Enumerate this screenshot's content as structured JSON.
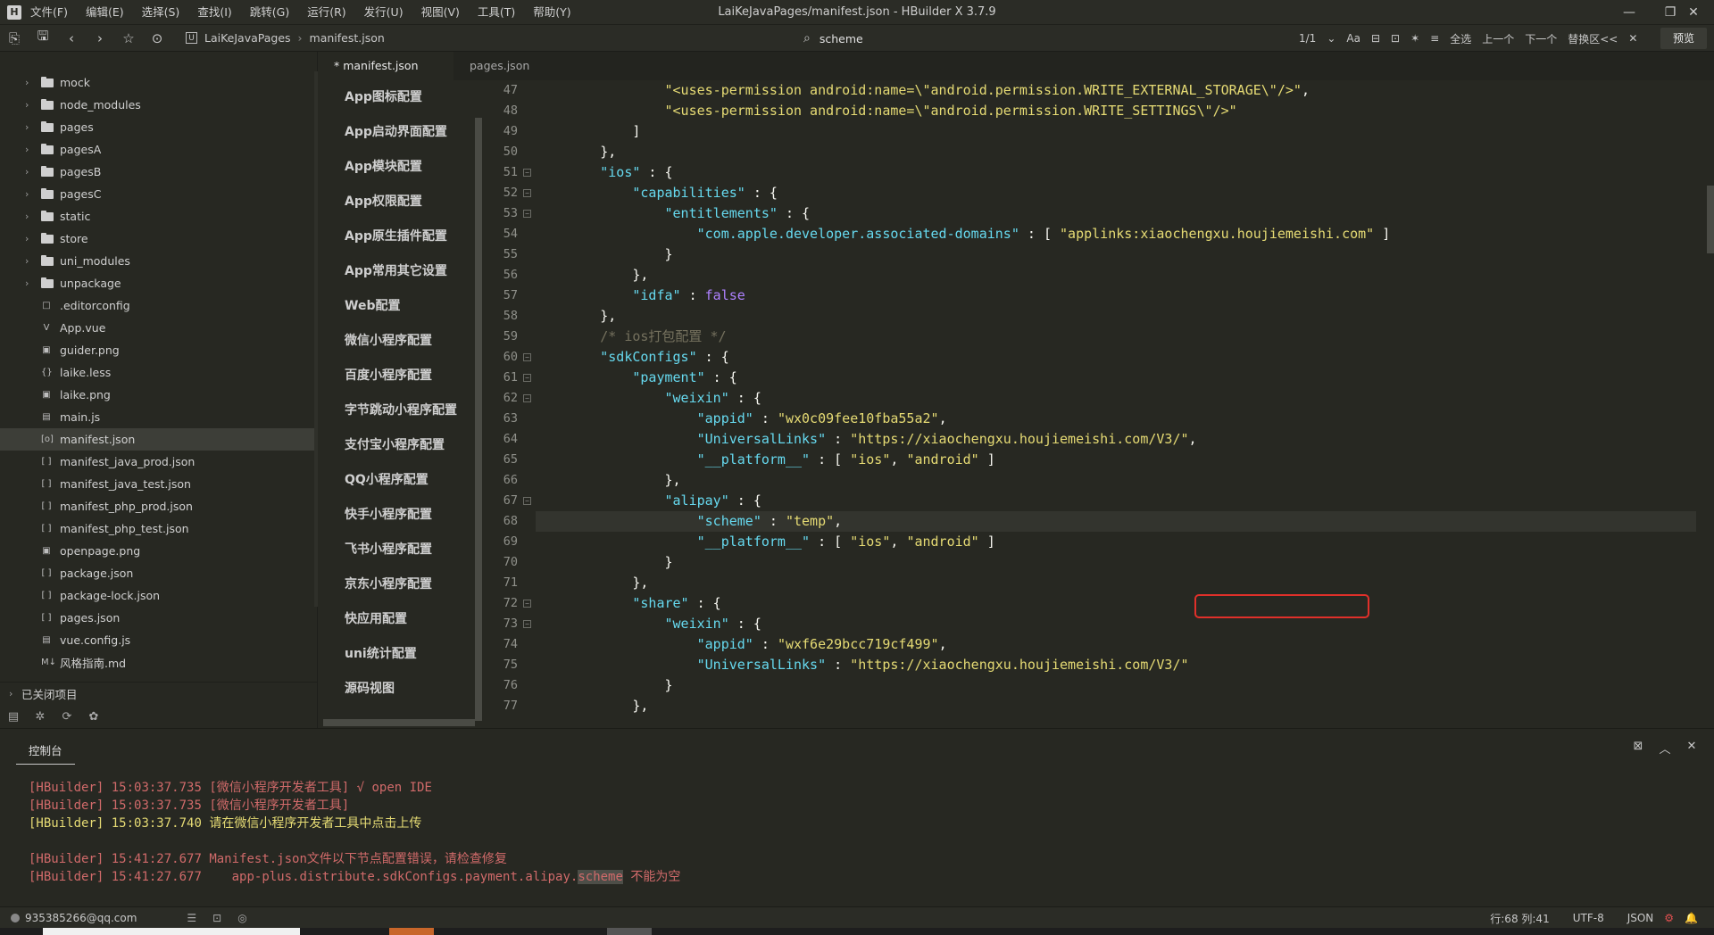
{
  "titlebar": {
    "menus": [
      "文件(F)",
      "编辑(E)",
      "选择(S)",
      "查找(I)",
      "跳转(G)",
      "运行(R)",
      "发行(U)",
      "视图(V)",
      "工具(T)",
      "帮助(Y)"
    ],
    "title": "LaiKeJavaPages/manifest.json - HBuilder X 3.7.9"
  },
  "toolbar": {
    "breadcrumb": [
      "LaiKeJavaPages",
      "manifest.json"
    ],
    "find_value": "scheme",
    "match_count": "1/1",
    "select_all": "全选",
    "prev": "上一个",
    "next": "下一个",
    "replace": "替换区<<",
    "preview": "预览"
  },
  "sidebar": {
    "items": [
      {
        "label": "mock",
        "type": "folder"
      },
      {
        "label": "node_modules",
        "type": "folder"
      },
      {
        "label": "pages",
        "type": "folder"
      },
      {
        "label": "pagesA",
        "type": "folder"
      },
      {
        "label": "pagesB",
        "type": "folder"
      },
      {
        "label": "pagesC",
        "type": "folder"
      },
      {
        "label": "static",
        "type": "folder"
      },
      {
        "label": "store",
        "type": "folder"
      },
      {
        "label": "uni_modules",
        "type": "folder"
      },
      {
        "label": "unpackage",
        "type": "folder"
      },
      {
        "label": ".editorconfig",
        "type": "file",
        "icon": "□"
      },
      {
        "label": "App.vue",
        "type": "file",
        "icon": "V"
      },
      {
        "label": "guider.png",
        "type": "file",
        "icon": "▣"
      },
      {
        "label": "laike.less",
        "type": "file",
        "icon": "{}"
      },
      {
        "label": "laike.png",
        "type": "file",
        "icon": "▣"
      },
      {
        "label": "main.js",
        "type": "file",
        "icon": "▤"
      },
      {
        "label": "manifest.json",
        "type": "file",
        "icon": "[o]",
        "selected": true
      },
      {
        "label": "manifest_java_prod.json",
        "type": "file",
        "icon": "[ ]"
      },
      {
        "label": "manifest_java_test.json",
        "type": "file",
        "icon": "[ ]"
      },
      {
        "label": "manifest_php_prod.json",
        "type": "file",
        "icon": "[ ]"
      },
      {
        "label": "manifest_php_test.json",
        "type": "file",
        "icon": "[ ]"
      },
      {
        "label": "openpage.png",
        "type": "file",
        "icon": "▣"
      },
      {
        "label": "package.json",
        "type": "file",
        "icon": "[ ]"
      },
      {
        "label": "package-lock.json",
        "type": "file",
        "icon": "[ ]"
      },
      {
        "label": "pages.json",
        "type": "file",
        "icon": "[ ]"
      },
      {
        "label": "vue.config.js",
        "type": "file",
        "icon": "▤"
      },
      {
        "label": "风格指南.md",
        "type": "file",
        "icon": "M↓"
      }
    ],
    "closed_projects": "已关闭项目"
  },
  "tabs": [
    {
      "label": "* manifest.json",
      "active": true
    },
    {
      "label": "pages.json",
      "active": false
    }
  ],
  "config_menu": [
    "App图标配置",
    "App启动界面配置",
    "App模块配置",
    "App权限配置",
    "App原生插件配置",
    "App常用其它设置",
    "Web配置",
    "微信小程序配置",
    "百度小程序配置",
    "字节跳动小程序配置",
    "支付宝小程序配置",
    "QQ小程序配置",
    "快手小程序配置",
    "飞书小程序配置",
    "京东小程序配置",
    "快应用配置",
    "uni统计配置",
    "源码视图"
  ],
  "editor": {
    "line_numbers": [
      "47",
      "48",
      "49",
      "50",
      "51",
      "52",
      "53",
      "54",
      "55",
      "56",
      "57",
      "58",
      "59",
      "60",
      "61",
      "62",
      "63",
      "64",
      "65",
      "66",
      "67",
      "68",
      "69",
      "70",
      "71",
      "72",
      "73",
      "74",
      "75",
      "76",
      "77"
    ],
    "lines": [
      "                \"<uses-permission android:name=\\\"android.permission.WRITE_EXTERNAL_STORAGE\\\"/>\",",
      "                \"<uses-permission android:name=\\\"android.permission.WRITE_SETTINGS\\\"/>\"",
      "            ]",
      "        },",
      "        \"ios\" : {",
      "            \"capabilities\" : {",
      "                \"entitlements\" : {",
      "                    \"com.apple.developer.associated-domains\" : [ \"applinks:xiaochengxu.houjiemeishi.com\" ]",
      "                }",
      "            },",
      "            \"idfa\" : false",
      "        },",
      "        /* ios打包配置 */",
      "        \"sdkConfigs\" : {",
      "            \"payment\" : {",
      "                \"weixin\" : {",
      "                    \"appid\" : \"wx0c09fee10fba55a2\",",
      "                    \"UniversalLinks\" : \"https://xiaochengxu.houjiemeishi.com/V3/\",",
      "                    \"__platform__\" : [ \"ios\", \"android\" ]",
      "                },",
      "                \"alipay\" : {",
      "                    \"scheme\" : \"temp\",",
      "                    \"__platform__\" : [ \"ios\", \"android\" ]",
      "                }",
      "            },",
      "            \"share\" : {",
      "                \"weixin\" : {",
      "                    \"appid\" : \"wxf6e29bcc719cf499\",",
      "                    \"UniversalLinks\" : \"https://xiaochengxu.houjiemeishi.com/V3/\"",
      "                }",
      "            },"
    ]
  },
  "console": {
    "tab": "控制台",
    "lines": [
      {
        "tag": "[HBuilder]",
        "time": "15:03:37.735",
        "msg": "[微信小程序开发者工具] √ open IDE",
        "level": "red"
      },
      {
        "tag": "[HBuilder]",
        "time": "15:03:37.735",
        "msg": "[微信小程序开发者工具]",
        "level": "red"
      },
      {
        "tag": "[HBuilder]",
        "time": "15:03:37.740",
        "msg": "请在微信小程序开发者工具中点击上传",
        "level": "yellow"
      },
      {
        "tag": "",
        "time": "",
        "msg": "",
        "level": "none"
      },
      {
        "tag": "[HBuilder]",
        "time": "15:41:27.677",
        "msg": "Manifest.json文件以下节点配置错误，请检查修复",
        "level": "red"
      },
      {
        "tag": "[HBuilder]",
        "time": "15:41:27.677",
        "msg_prefix": "   app-plus.distribute.sdkConfigs.payment.alipay.",
        "msg_hl": "scheme",
        "msg_suffix": " 不能为空",
        "level": "red"
      }
    ]
  },
  "statusbar": {
    "user": "935385266@qq.com",
    "position": "行:68  列:41",
    "encoding": "UTF-8",
    "language": "JSON"
  }
}
